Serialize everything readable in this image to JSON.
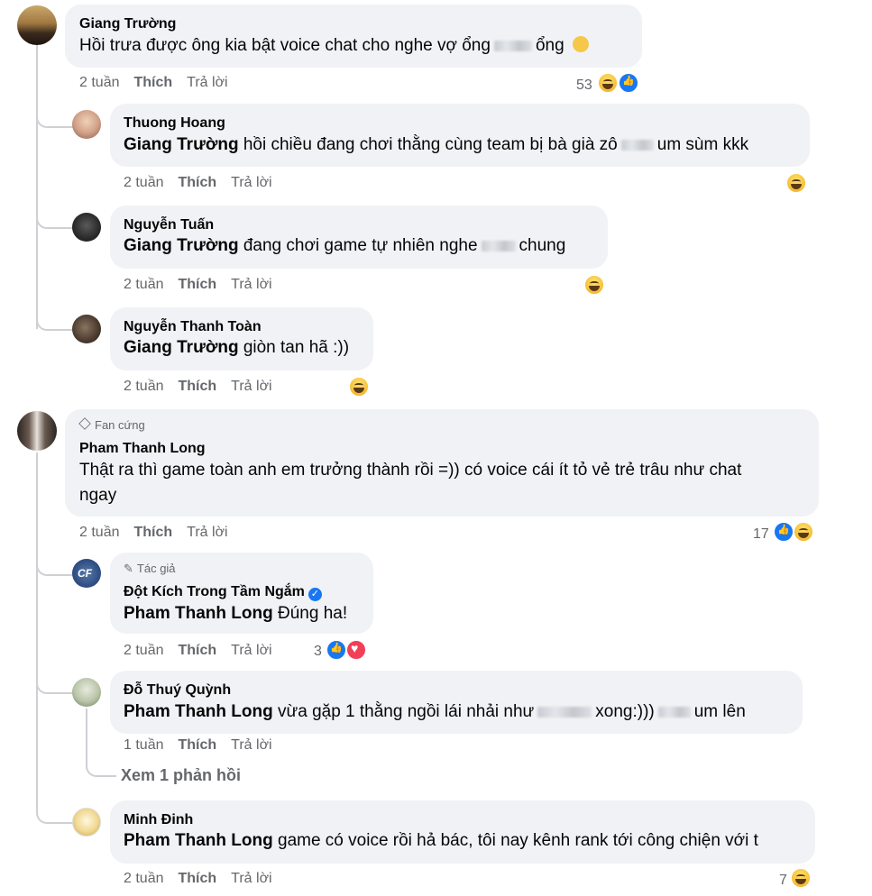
{
  "comments": [
    {
      "name": "Giang Trường",
      "text_a": "Hồi trưa được ông kia bật voice chat cho nghe vợ ổng",
      "text_b": "ổng",
      "time": "2 tuần",
      "like": "Thích",
      "reply": "Trả lời",
      "reactions": "53"
    },
    {
      "name": "Thuong Hoang",
      "mention": "Giang Trường",
      "text_a": " hồi chiều đang chơi thằng cùng team bị bà già zô",
      "text_b": "um sùm kkk",
      "time": "2 tuần",
      "like": "Thích",
      "reply": "Trả lời"
    },
    {
      "name": "Nguyễn Tuấn",
      "mention": "Giang Trường",
      "text_a": " đang chơi game tự nhiên nghe",
      "text_b": "chung",
      "time": "2 tuần",
      "like": "Thích",
      "reply": "Trả lời"
    },
    {
      "name": "Nguyễn Thanh Toàn",
      "mention": "Giang Trường",
      "text_a": " giòn tan hã :))",
      "time": "2 tuần",
      "like": "Thích",
      "reply": "Trả lời"
    },
    {
      "badge": "Fan cứng",
      "name": "Pham Thanh Long",
      "line1": "Thật ra thì game toàn anh em trưởng thành rồi =)) có voice cái ít tỏ vẻ trẻ trâu như chat",
      "line2": "ngay",
      "time": "2 tuần",
      "like": "Thích",
      "reply": "Trả lời",
      "reactions": "17"
    },
    {
      "badge": "Tác giả",
      "name": "Đột Kích Trong Tầm Ngắm",
      "mention": "Pham Thanh Long",
      "text_a": " Đúng ha!",
      "time": "2 tuần",
      "like": "Thích",
      "reply": "Trả lời",
      "reactions": "3"
    },
    {
      "name": "Đỗ Thuý Quỳnh",
      "mention": "Pham Thanh Long",
      "text_a": " vừa gặp 1 thằng ngồi lái nhải như",
      "text_b": "xong:)))",
      "text_c": "um lên",
      "time": "1 tuần",
      "like": "Thích",
      "reply": "Trả lời",
      "view_more": "Xem 1 phản hồi"
    },
    {
      "name": "Minh Đinh",
      "mention": "Pham Thanh Long",
      "text_a": " game có voice rồi hả bác, tôi nay kênh rank tới công chiện với t",
      "time": "2 tuần",
      "like": "Thích",
      "reply": "Trả lời",
      "reactions": "7"
    }
  ],
  "colors": {
    "bubble": "#f0f2f5",
    "meta": "#65676b",
    "like_blue": "#1877f2",
    "heart_red": "#f33e58"
  }
}
